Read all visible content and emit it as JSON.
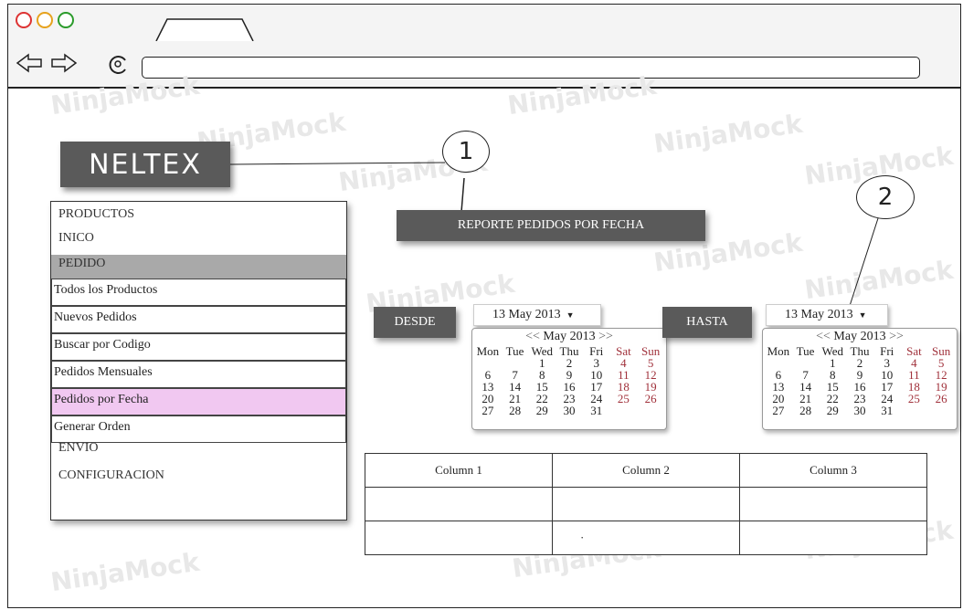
{
  "browser": {
    "tab_title": "",
    "url": ""
  },
  "watermark": "NinjaMock",
  "logo": {
    "text": "NELTEX"
  },
  "callouts": {
    "one": "1",
    "two": "2"
  },
  "menu": {
    "items": [
      "PRODUCTOS",
      "INICO",
      "PEDIDO"
    ],
    "submenu": [
      "Todos los Productos",
      "Nuevos Pedidos",
      "Buscar por Codigo",
      "Pedidos Mensuales",
      "Pedidos por Fecha",
      "Generar Orden"
    ],
    "after": [
      "ENVIO",
      "CONFIGURACION"
    ]
  },
  "report_button": "REPORTE PEDIDOS POR FECHA",
  "desde": {
    "label": "DESDE",
    "date_value": "13 May 2013",
    "calendar": {
      "prev": "<<",
      "month": "May 2013",
      "next": ">>"
    }
  },
  "hasta": {
    "label": "HASTA",
    "date_value": "13 May 2013",
    "calendar": {
      "prev": "<<",
      "month": "May 2013",
      "next": ">>"
    }
  },
  "weekdays": [
    "Mon",
    "Tue",
    "Wed",
    "Thu",
    "Fri",
    "Sat",
    "Sun"
  ],
  "calendar_days": [
    [
      "",
      "",
      "1",
      "2",
      "3",
      "4",
      "5"
    ],
    [
      "6",
      "7",
      "8",
      "9",
      "10",
      "11",
      "12"
    ],
    [
      "13",
      "14",
      "15",
      "16",
      "17",
      "18",
      "19"
    ],
    [
      "20",
      "21",
      "22",
      "23",
      "24",
      "25",
      "26"
    ],
    [
      "27",
      "28",
      "29",
      "30",
      "31",
      "",
      ""
    ]
  ],
  "table": {
    "columns": [
      "Column 1",
      "Column 2",
      "Column 3"
    ],
    "rows": [
      [
        "",
        "",
        ""
      ],
      [
        "",
        "·",
        ""
      ]
    ]
  },
  "colors": {
    "accent_dark": "#5a5a5a",
    "selected": "#f1c8f1",
    "header_bar": "#a9a9a9",
    "weekend": "#a0303a"
  }
}
